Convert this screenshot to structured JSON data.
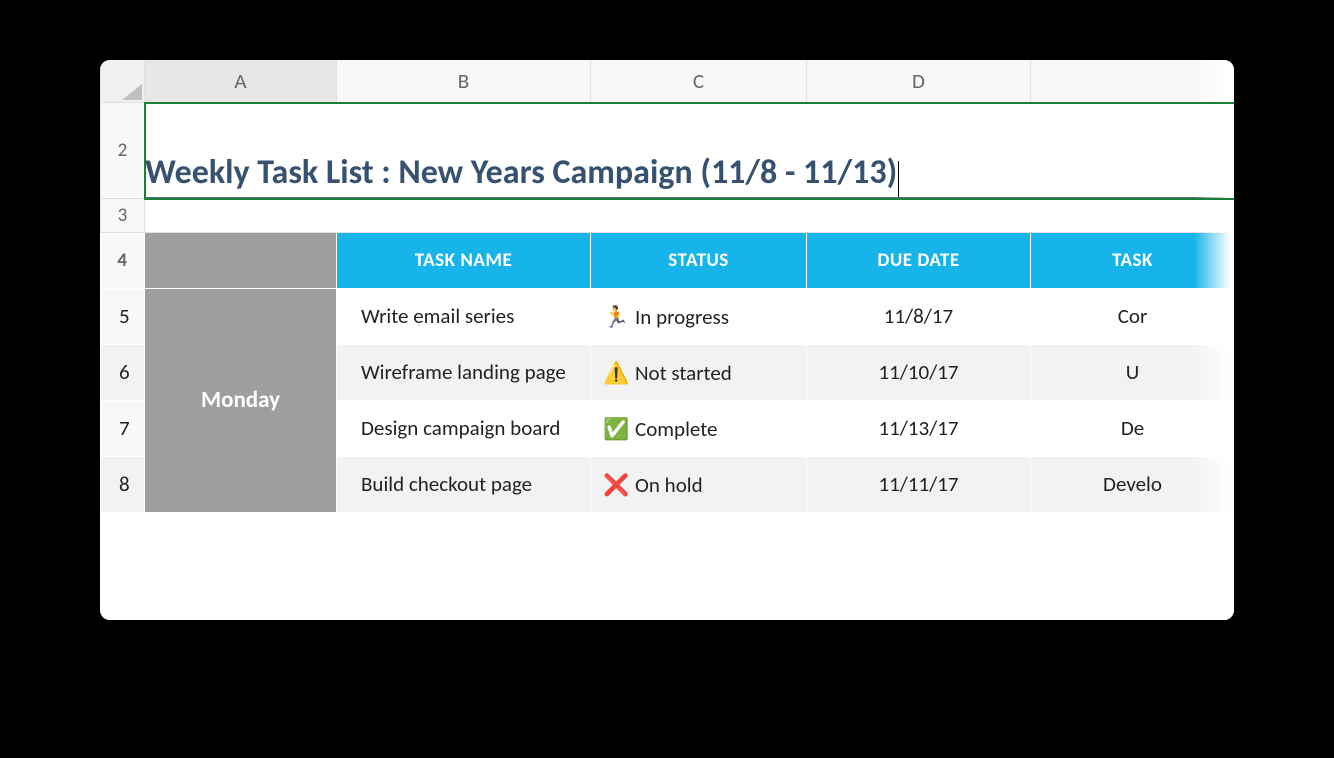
{
  "columns": [
    "A",
    "B",
    "C",
    "D",
    ""
  ],
  "row_numbers": [
    "2",
    "3",
    "4",
    "5",
    "6",
    "7",
    "8"
  ],
  "title": "Weekly Task List : New Years Campaign (11/8 - 11/13)",
  "headers": {
    "task_name": "TASK NAME",
    "status": "STATUS",
    "due_date": "DUE DATE",
    "extra": "TASK"
  },
  "day_label": "Monday",
  "status_icons": {
    "in_progress": "🏃",
    "not_started": "⚠️",
    "complete": "✅",
    "on_hold": "❌"
  },
  "rows": [
    {
      "task": "Write email series",
      "status_key": "in_progress",
      "status": "In progress",
      "due": "11/8/17",
      "extra": "Cor"
    },
    {
      "task": "Wireframe landing page",
      "status_key": "not_started",
      "status": "Not started",
      "due": "11/10/17",
      "extra": "U"
    },
    {
      "task": "Design campaign board",
      "status_key": "complete",
      "status": "Complete",
      "due": "11/13/17",
      "extra": "De"
    },
    {
      "task": "Build checkout page",
      "status_key": "on_hold",
      "status": "On hold",
      "due": "11/11/17",
      "extra": "Develo"
    }
  ]
}
